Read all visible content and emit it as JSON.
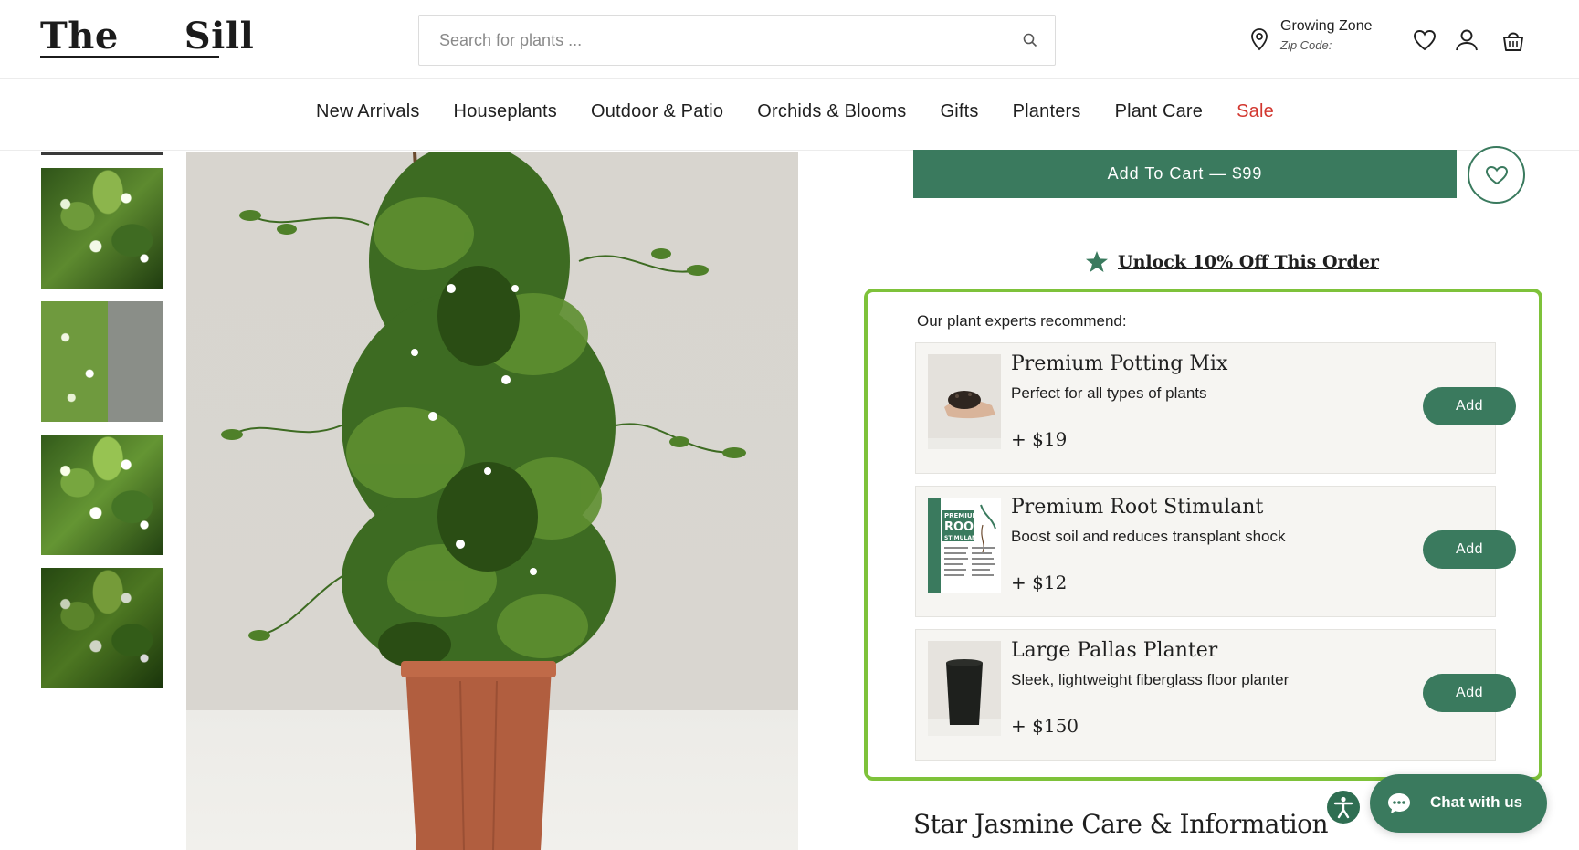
{
  "header": {
    "logo_left": "The",
    "logo_right": "Sill",
    "search_placeholder": "Search for plants ...",
    "zone_title": "Growing Zone",
    "zone_sub": "Zip Code:"
  },
  "nav": {
    "items": [
      "New Arrivals",
      "Houseplants",
      "Outdoor & Patio",
      "Orchids & Blooms",
      "Gifts",
      "Planters",
      "Plant Care",
      "Sale"
    ]
  },
  "product": {
    "cart_label": "Add To Cart — $99",
    "unlock_label": "Unlock 10% Off This Order"
  },
  "recommend": {
    "title": "Our plant experts recommend:",
    "items": [
      {
        "name": "Premium Potting Mix",
        "desc": "Perfect for all types of plants",
        "price": "+ $19",
        "add": "Add"
      },
      {
        "name": "Premium Root Stimulant",
        "desc": "Boost soil and reduces transplant shock",
        "price": "+ $12",
        "add": "Add"
      },
      {
        "name": "Large Pallas Planter",
        "desc": "Sleek, lightweight fiberglass floor planter",
        "price": "+ $150",
        "add": "Add"
      }
    ],
    "stimulant_label_top": "PREMIUM",
    "stimulant_label_mid": "ROOT",
    "stimulant_label_bot": "STIMULANT"
  },
  "care": {
    "title": "Star Jasmine Care & Information"
  },
  "chat": {
    "label": "Chat with us"
  },
  "colors": {
    "brand_green": "#3a7a5e",
    "highlight_border": "#7ec23a",
    "sale_red": "#d2372f"
  },
  "icons": [
    "search-icon",
    "location-pin-icon",
    "heart-icon",
    "user-icon",
    "cart-icon",
    "star-icon",
    "accessibility-icon",
    "chat-bubble-icon"
  ]
}
